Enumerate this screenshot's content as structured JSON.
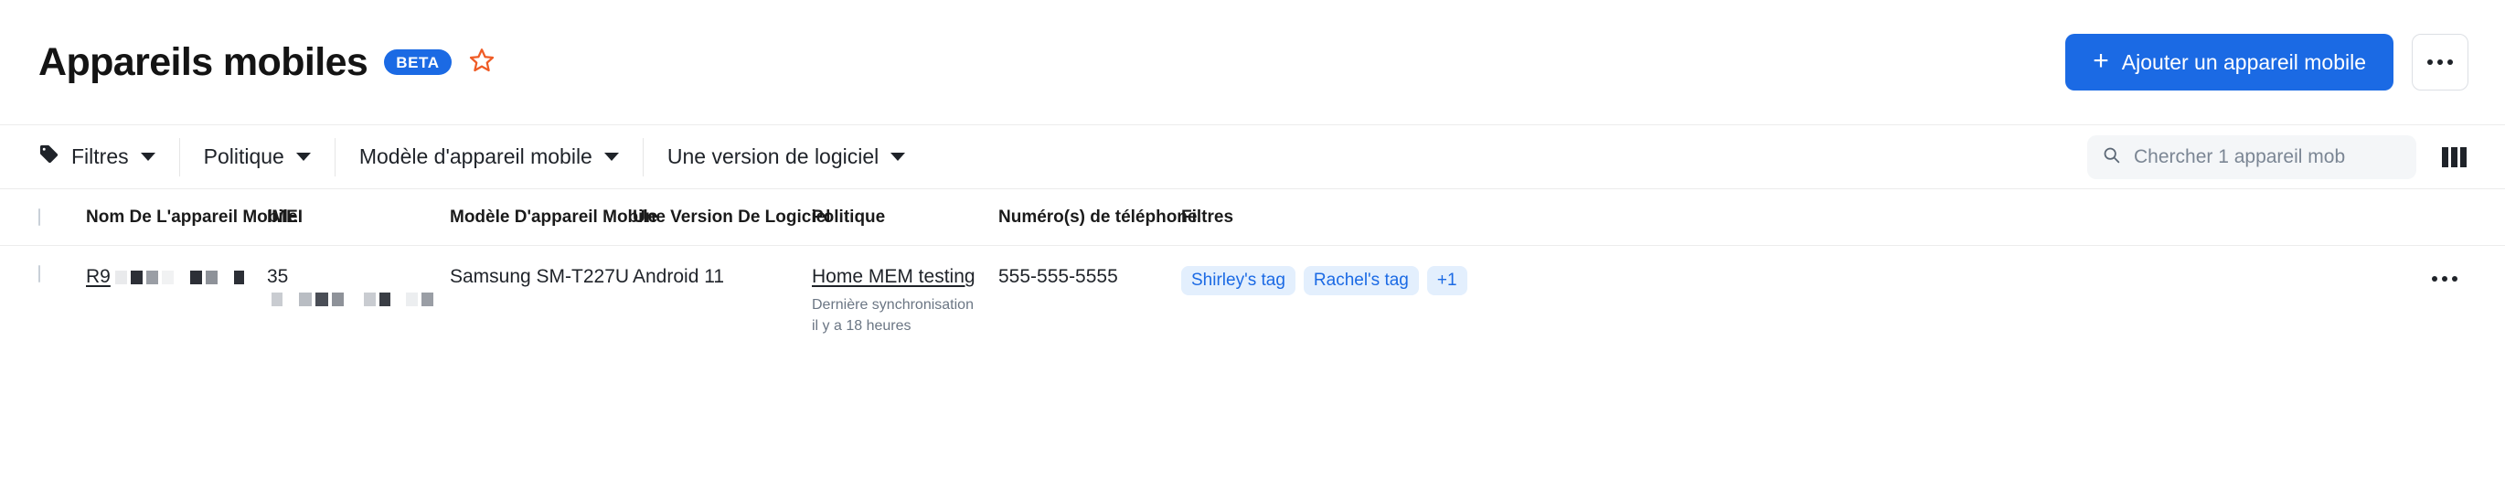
{
  "header": {
    "title": "Appareils mobiles",
    "beta_badge": "BETA",
    "favorite_icon": "star-icon",
    "favorite_color": "#ef5b25",
    "add_button_label": "Ajouter un appareil mobile",
    "add_button_plus": "+",
    "overflow_menu_label": "•••"
  },
  "filter_bar": {
    "items": [
      {
        "label": "Filtres",
        "icon": "tag-icon",
        "has_caret": true
      },
      {
        "label": "Politique",
        "icon": "",
        "has_caret": true
      },
      {
        "label": "Modèle d'appareil mobile",
        "icon": "",
        "has_caret": true
      },
      {
        "label": "Une version de logiciel",
        "icon": "",
        "has_caret": true
      }
    ],
    "search": {
      "placeholder": "Chercher 1 appareil mob",
      "value": "",
      "icon": "search-icon"
    },
    "columns_icon": "columns-icon"
  },
  "table": {
    "columns": [
      "Nom De L'appareil Mobile",
      "IMEI",
      "Modèle D'appareil Mobile",
      "Une Version De Logiciel",
      "Politique",
      "Numéro(s) de téléphone",
      "Filtres"
    ],
    "rows": [
      {
        "name": "R9",
        "name_redacted": true,
        "imei": "35",
        "imei_redacted": true,
        "model": "Samsung SM-T227U",
        "software_version": "Android 11",
        "policy": "Home MEM testing",
        "policy_sub": "Dernière synchronisation il y a 18 heures",
        "phone": "555-555-5555",
        "tags": [
          "Shirley's tag",
          "Rachel's tag",
          "+1"
        ],
        "row_menu": "•••"
      }
    ]
  },
  "colors": {
    "accent": "#1b6ae4",
    "star": "#ef5b25",
    "tag_bg": "#e3effd",
    "tag_text": "#1b6ae4",
    "muted_text": "#6b7684"
  }
}
